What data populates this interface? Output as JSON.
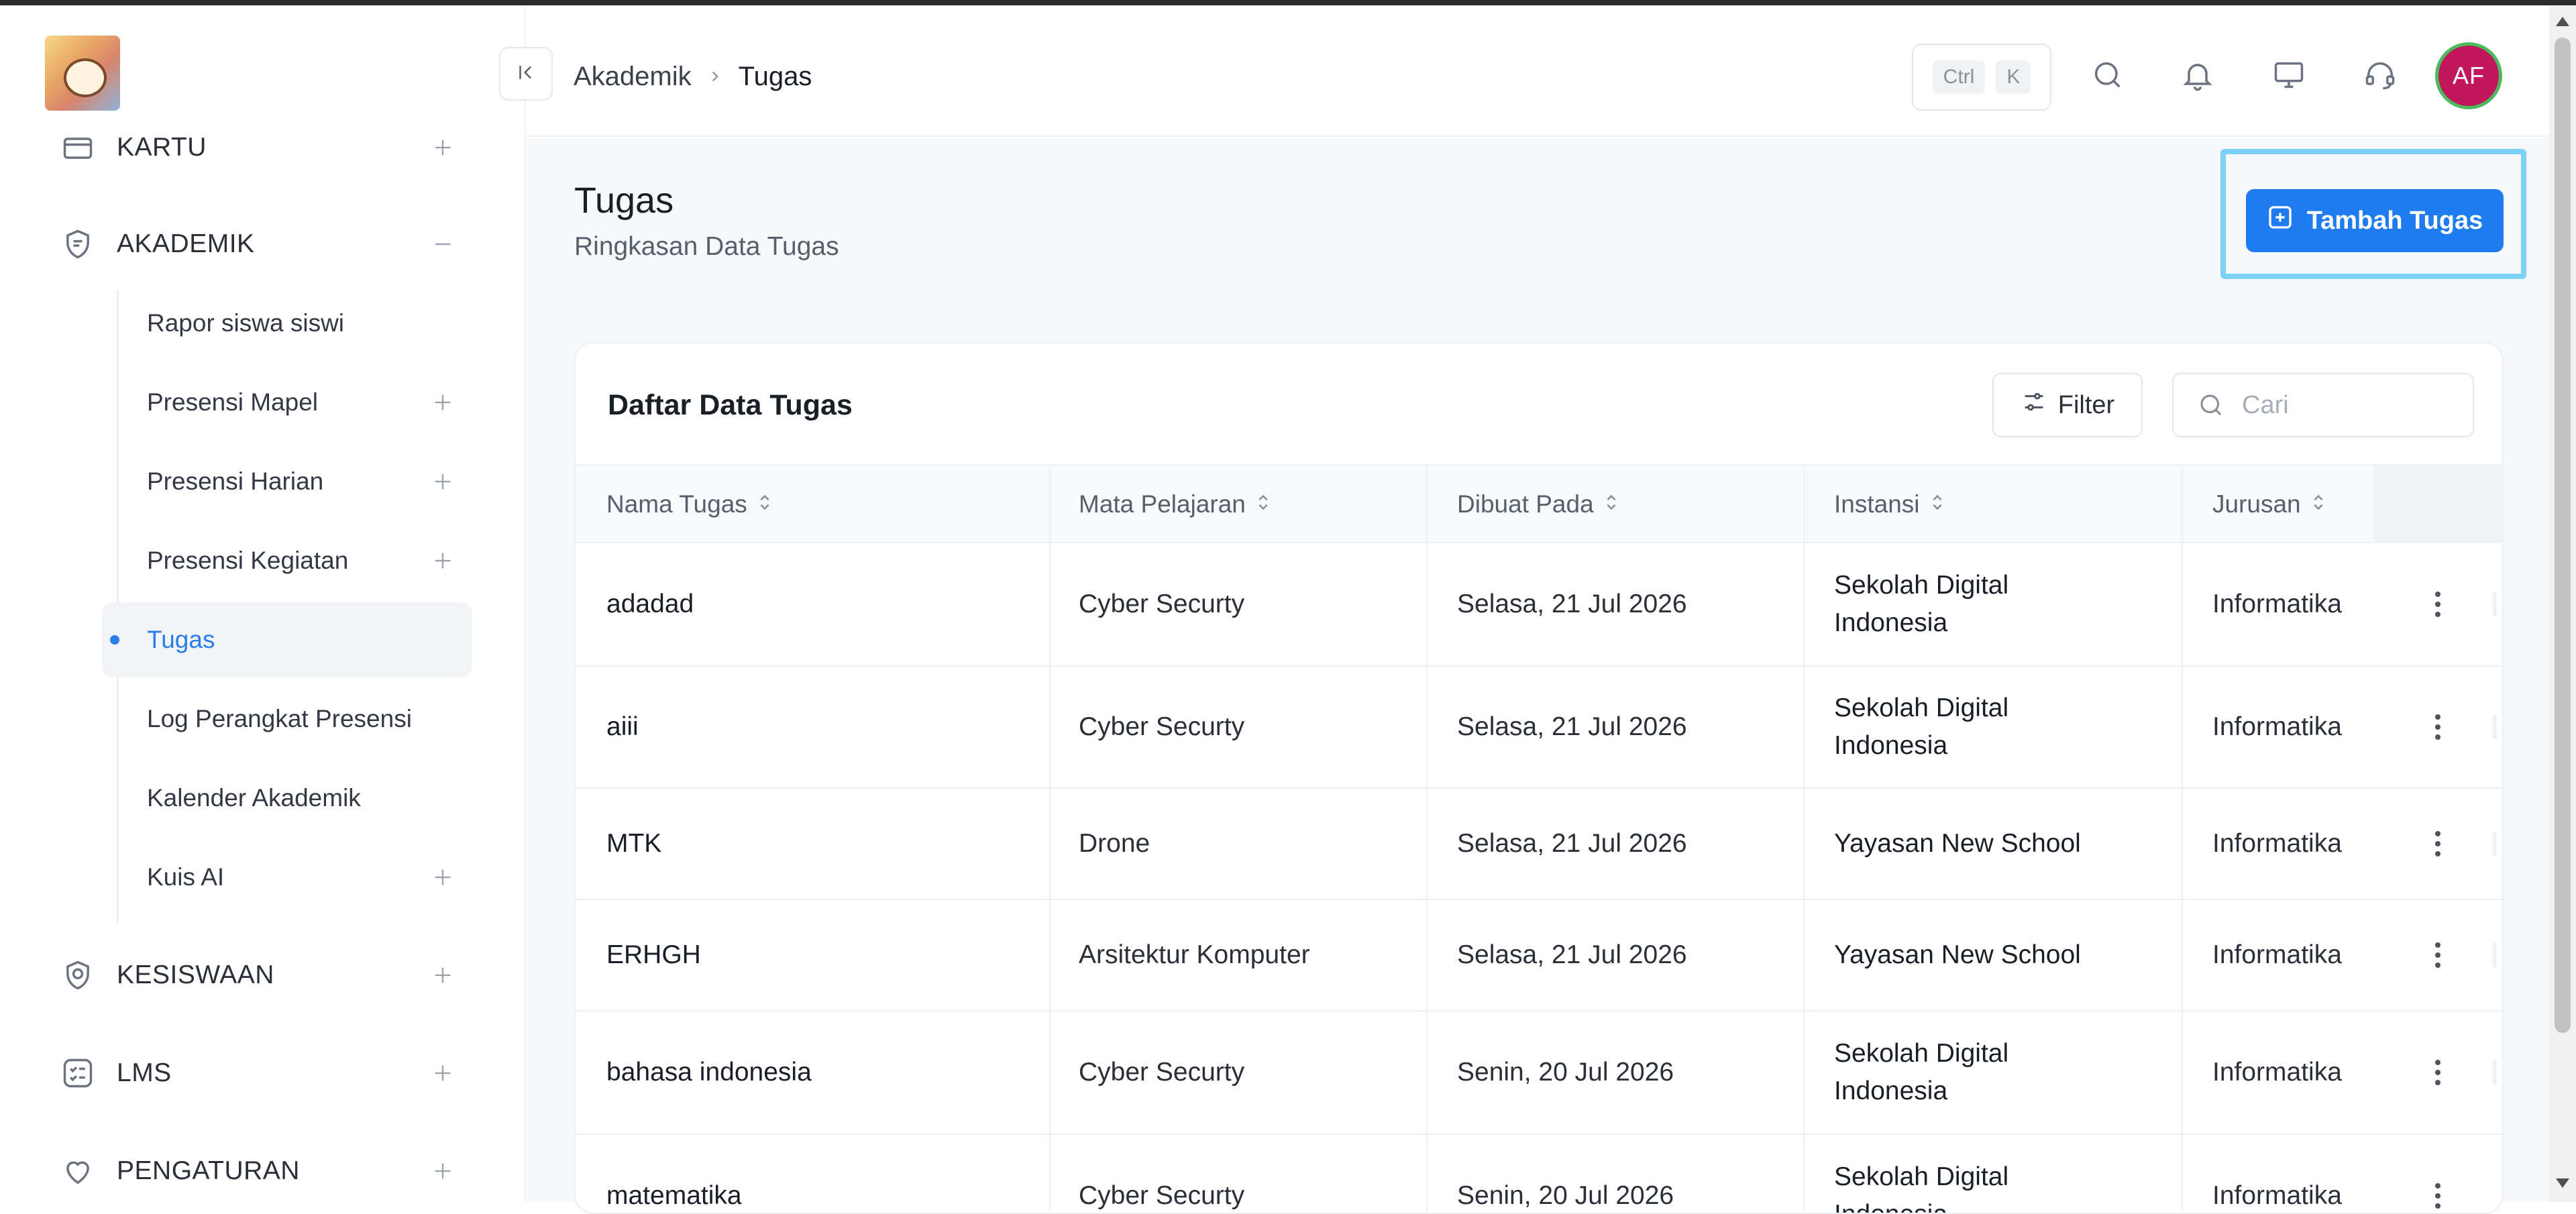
{
  "sidebar": {
    "groups": [
      {
        "label": "KARTU",
        "toggle": "+"
      },
      {
        "label": "AKADEMIK",
        "toggle": "−"
      },
      {
        "label": "KESISWAAN",
        "toggle": "+"
      },
      {
        "label": "LMS",
        "toggle": "+"
      },
      {
        "label": "PENGATURAN",
        "toggle": "+"
      }
    ],
    "akademik_items": [
      {
        "label": "Rapor siswa siswi"
      },
      {
        "label": "Presensi Mapel"
      },
      {
        "label": "Presensi Harian"
      },
      {
        "label": "Presensi Kegiatan"
      },
      {
        "label": "Tugas"
      },
      {
        "label": "Log Perangkat Presensi"
      },
      {
        "label": "Kalender Akademik"
      },
      {
        "label": "Kuis AI"
      }
    ]
  },
  "header": {
    "breadcrumb": [
      "Akademik",
      "Tugas"
    ],
    "shortcut_keys": [
      "Ctrl",
      "K"
    ],
    "avatar_initials": "AF"
  },
  "page": {
    "title": "Tugas",
    "subtitle": "Ringkasan Data Tugas",
    "add_button_label": "Tambah Tugas"
  },
  "card": {
    "title": "Daftar Data Tugas",
    "filter_label": "Filter",
    "search_placeholder": "Cari"
  },
  "table": {
    "columns": [
      "Nama Tugas",
      "Mata Pelajaran",
      "Dibuat Pada",
      "Instansi",
      "Jurusan"
    ],
    "rows": [
      {
        "nama": "adadad",
        "mapel": "Cyber Securty",
        "dibuat": "Selasa, 21 Jul 2026",
        "instansi": "Sekolah Digital Indonesia",
        "jurusan": "Informatika"
      },
      {
        "nama": "aiii",
        "mapel": "Cyber Securty",
        "dibuat": "Selasa, 21 Jul 2026",
        "instansi": "Sekolah Digital Indonesia",
        "jurusan": "Informatika"
      },
      {
        "nama": "MTK",
        "mapel": "Drone",
        "dibuat": "Selasa, 21 Jul 2026",
        "instansi": "Yayasan New School",
        "jurusan": "Informatika"
      },
      {
        "nama": "ERHGH",
        "mapel": "Arsitektur Komputer",
        "dibuat": "Selasa, 21 Jul 2026",
        "instansi": "Yayasan New School",
        "jurusan": "Informatika"
      },
      {
        "nama": "bahasa indonesia",
        "mapel": "Cyber Securty",
        "dibuat": "Senin, 20 Jul 2026",
        "instansi": "Sekolah Digital Indonesia",
        "jurusan": "Informatika"
      },
      {
        "nama": "matematika",
        "mapel": "Cyber Securty",
        "dibuat": "Senin, 20 Jul 2026",
        "instansi": "Sekolah Digital Indonesia",
        "jurusan": "Informatika"
      }
    ]
  },
  "colors": {
    "accent": "#1f7cf0",
    "active_text": "#2b7de9",
    "avatar_bg": "#c2185b",
    "avatar_ring": "#4cbb5e",
    "highlight": "#7dd1f5"
  },
  "icons": {
    "collapse": "collapse-sidebar-icon",
    "search": "search-icon",
    "bell": "bell-icon",
    "monitor": "monitor-icon",
    "support": "headset-icon",
    "add": "plus-square-icon",
    "filter": "sliders-icon",
    "sort": "sort-icon",
    "row_menu": "kebab-menu-icon"
  }
}
